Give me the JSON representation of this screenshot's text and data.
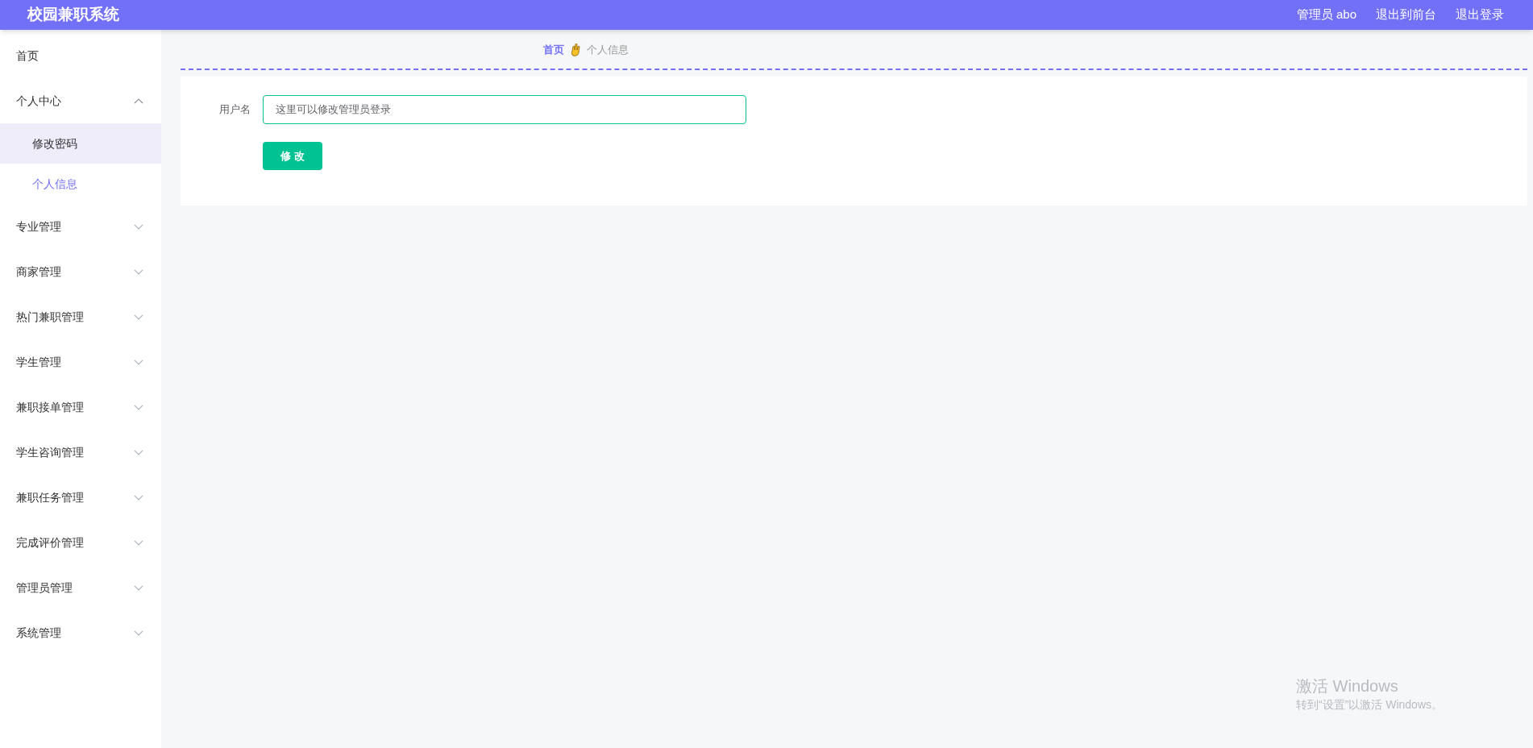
{
  "header": {
    "title": "校园兼职系统",
    "links": [
      {
        "label": "管理员 abo"
      },
      {
        "label": "退出到前台"
      },
      {
        "label": "退出登录"
      }
    ]
  },
  "sidebar": {
    "items": [
      {
        "label": "首页",
        "kind": "link"
      },
      {
        "label": "个人中心",
        "kind": "group",
        "expanded": true,
        "children": [
          {
            "label": "修改密码",
            "selected": false,
            "hovered": true
          },
          {
            "label": "个人信息",
            "selected": true,
            "hovered": false
          }
        ]
      },
      {
        "label": "专业管理",
        "kind": "group",
        "expanded": false
      },
      {
        "label": "商家管理",
        "kind": "group",
        "expanded": false
      },
      {
        "label": "热门兼职管理",
        "kind": "group",
        "expanded": false
      },
      {
        "label": "学生管理",
        "kind": "group",
        "expanded": false
      },
      {
        "label": "兼职接单管理",
        "kind": "group",
        "expanded": false
      },
      {
        "label": "学生咨询管理",
        "kind": "group",
        "expanded": false
      },
      {
        "label": "兼职任务管理",
        "kind": "group",
        "expanded": false
      },
      {
        "label": "完成评价管理",
        "kind": "group",
        "expanded": false
      },
      {
        "label": "管理员管理",
        "kind": "group",
        "expanded": false
      },
      {
        "label": "系统管理",
        "kind": "group",
        "expanded": false
      }
    ]
  },
  "breadcrumb": [
    {
      "label": "首页"
    },
    {
      "label": "个人信息"
    }
  ],
  "form": {
    "fields": [
      {
        "label": "用户名",
        "value": "这里可以修改管理员登录"
      }
    ],
    "button": "修 改"
  },
  "os_notice": {
    "title": "激活 Windows",
    "text": "转到“设置”以激活 Windows。"
  }
}
